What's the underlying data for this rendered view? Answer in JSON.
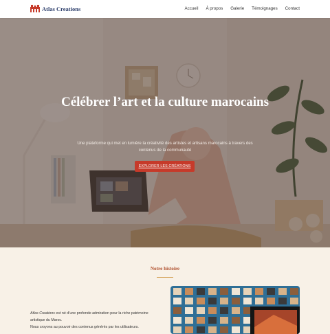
{
  "header": {
    "brand": "Atlas Creations",
    "nav": [
      "Accueil",
      "À propos",
      "Galerie",
      "Témoignages",
      "Contact"
    ]
  },
  "hero": {
    "title": "Célébrer l’art et la culture marocains",
    "subtitle": "Une plateforme qui met en lumière la créativité des artistes et artisans marocains à travers des contenus de la communauté",
    "cta_label": "EXPLORER LES CRÉATIONS"
  },
  "story": {
    "title": "Notre histoire",
    "brand_em": "Atlas Creations",
    "line1_rest": " est né d’une profonde admiration pour la riche patrimoine artistique du Maroc.",
    "line2": "Nous croyons au pouvoir des contenus générés par les utilisateurs."
  },
  "colors": {
    "accent": "#c63a2a",
    "brand": "#2c3e6b",
    "section_title": "#b0502e",
    "background": "#f8f1e7"
  }
}
